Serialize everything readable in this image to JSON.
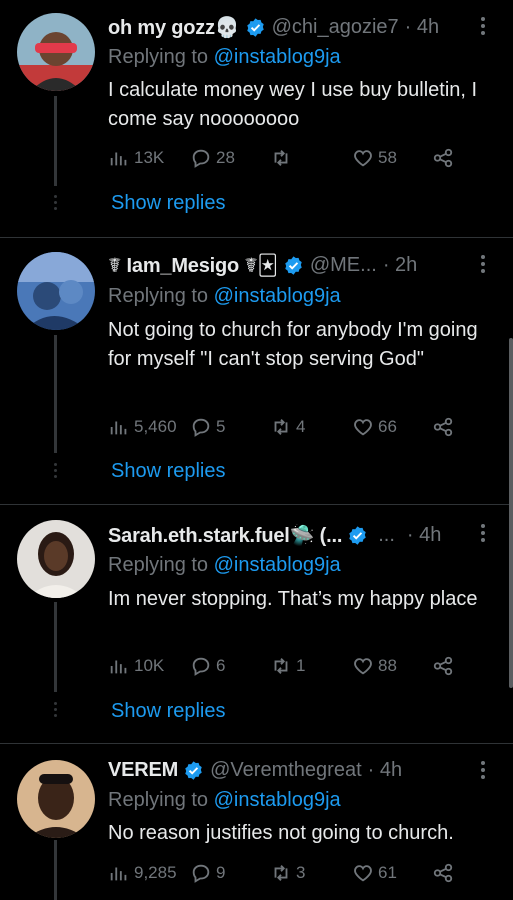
{
  "tweets": [
    {
      "name": "oh my gozz💀",
      "handle": "@chi_agozie7",
      "time": "· 4h",
      "replying_prefix": "Replying to",
      "replying_handle": "@instablog9ja",
      "text": "I calculate money wey I use buy bulletin, I come say noooooooo",
      "views": "13K",
      "replies": "28",
      "retweets": "",
      "likes": "58",
      "show_replies": "Show replies",
      "avatar_color": "#9bb8c8"
    },
    {
      "name": "☤ Iam_Mesigo ☤🃏",
      "handle": "@ME...",
      "time": "· 2h",
      "replying_prefix": "Replying to",
      "replying_handle": "@instablog9ja",
      "text": "Not going to church for anybody I'm going for myself  \"I can't stop serving God\"",
      "views": "5,460",
      "replies": "5",
      "retweets": "4",
      "likes": "66",
      "show_replies": "Show replies",
      "avatar_color": "#3a5f9a"
    },
    {
      "name": "Sarah.eth.stark.fuel🛸 (...",
      "handle": "...",
      "time": "· 4h",
      "replying_prefix": "Replying to",
      "replying_handle": "@instablog9ja",
      "text": "Im never stopping. That’s my happy place",
      "views": "10K",
      "replies": "6",
      "retweets": "1",
      "likes": "88",
      "show_replies": "Show replies",
      "avatar_color": "#d9d6d2"
    },
    {
      "name": "VEREM",
      "handle": "@Veremthegreat",
      "time": "· 4h",
      "replying_prefix": "Replying to",
      "replying_handle": "@instablog9ja",
      "text": "No reason justifies not going to church.",
      "views": "9,285",
      "replies": "9",
      "retweets": "3",
      "likes": "61",
      "show_replies": "",
      "avatar_color": "#c9a27a"
    }
  ],
  "colors": {
    "background": "#000000",
    "text": "#e7e9ea",
    "muted": "#71767b",
    "accent": "#1d9bf0",
    "separator": "#2f3336"
  },
  "icons": [
    "verified-badge-icon",
    "more-icon",
    "views-icon",
    "reply-icon",
    "retweet-icon",
    "like-icon",
    "share-icon"
  ]
}
